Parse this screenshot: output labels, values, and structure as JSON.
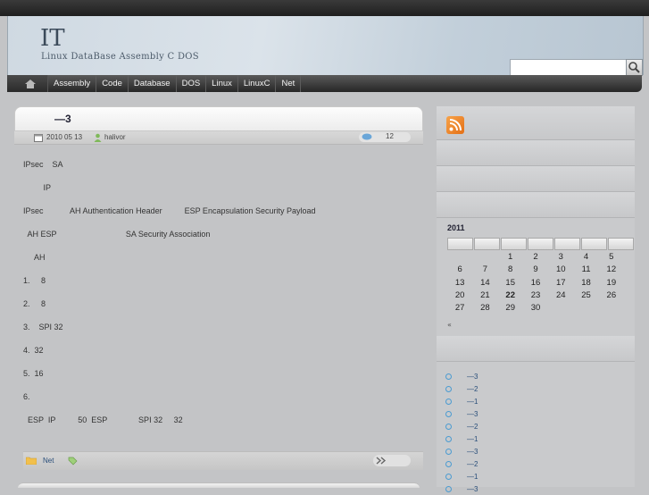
{
  "site": {
    "title": "IT",
    "description": "Linux  DataBase  Assembly  C         DOS"
  },
  "search": {
    "placeholder": ""
  },
  "nav": {
    "items": [
      "Assembly",
      "Code",
      "Database",
      "DOS",
      "Linux",
      "LinuxC",
      "Net"
    ]
  },
  "post": {
    "title": "—3",
    "date": "2010 05 13",
    "author": "halivor",
    "comments": "12",
    "paragraphs": [
      "IPsec    SA",
      "         IP",
      "IPsec            AH Authentication Header          ESP Encapsulation Security Payload",
      "  AH ESP                               SA Security Association",
      "     AH",
      "1.     8",
      "2.     8",
      "3.    SPI 32",
      "4.  32",
      "5.  16",
      "6.",
      "  ESP  IP          50  ESP              SPI 32     32"
    ],
    "category": "Net"
  },
  "calendar": {
    "title": "2011",
    "rows": [
      [
        "",
        "",
        "1",
        "2",
        "3",
        "4",
        "5"
      ],
      [
        "6",
        "7",
        "8",
        "9",
        "10",
        "11",
        "12"
      ],
      [
        "13",
        "14",
        "15",
        "16",
        "17",
        "18",
        "19"
      ],
      [
        "20",
        "21",
        "22",
        "23",
        "24",
        "25",
        "26"
      ],
      [
        "27",
        "28",
        "29",
        "30",
        "",
        "",
        ""
      ]
    ],
    "today": "22",
    "prev": "«"
  },
  "recent_posts": [
    "—3",
    "—2",
    "—1",
    "—3",
    "—2",
    "—1",
    "—3",
    "—2",
    "—1",
    "—3"
  ],
  "colors": {
    "accent_rss": "#f0882e",
    "link": "#2a4f7a",
    "bullet": "#4b9bd1"
  }
}
